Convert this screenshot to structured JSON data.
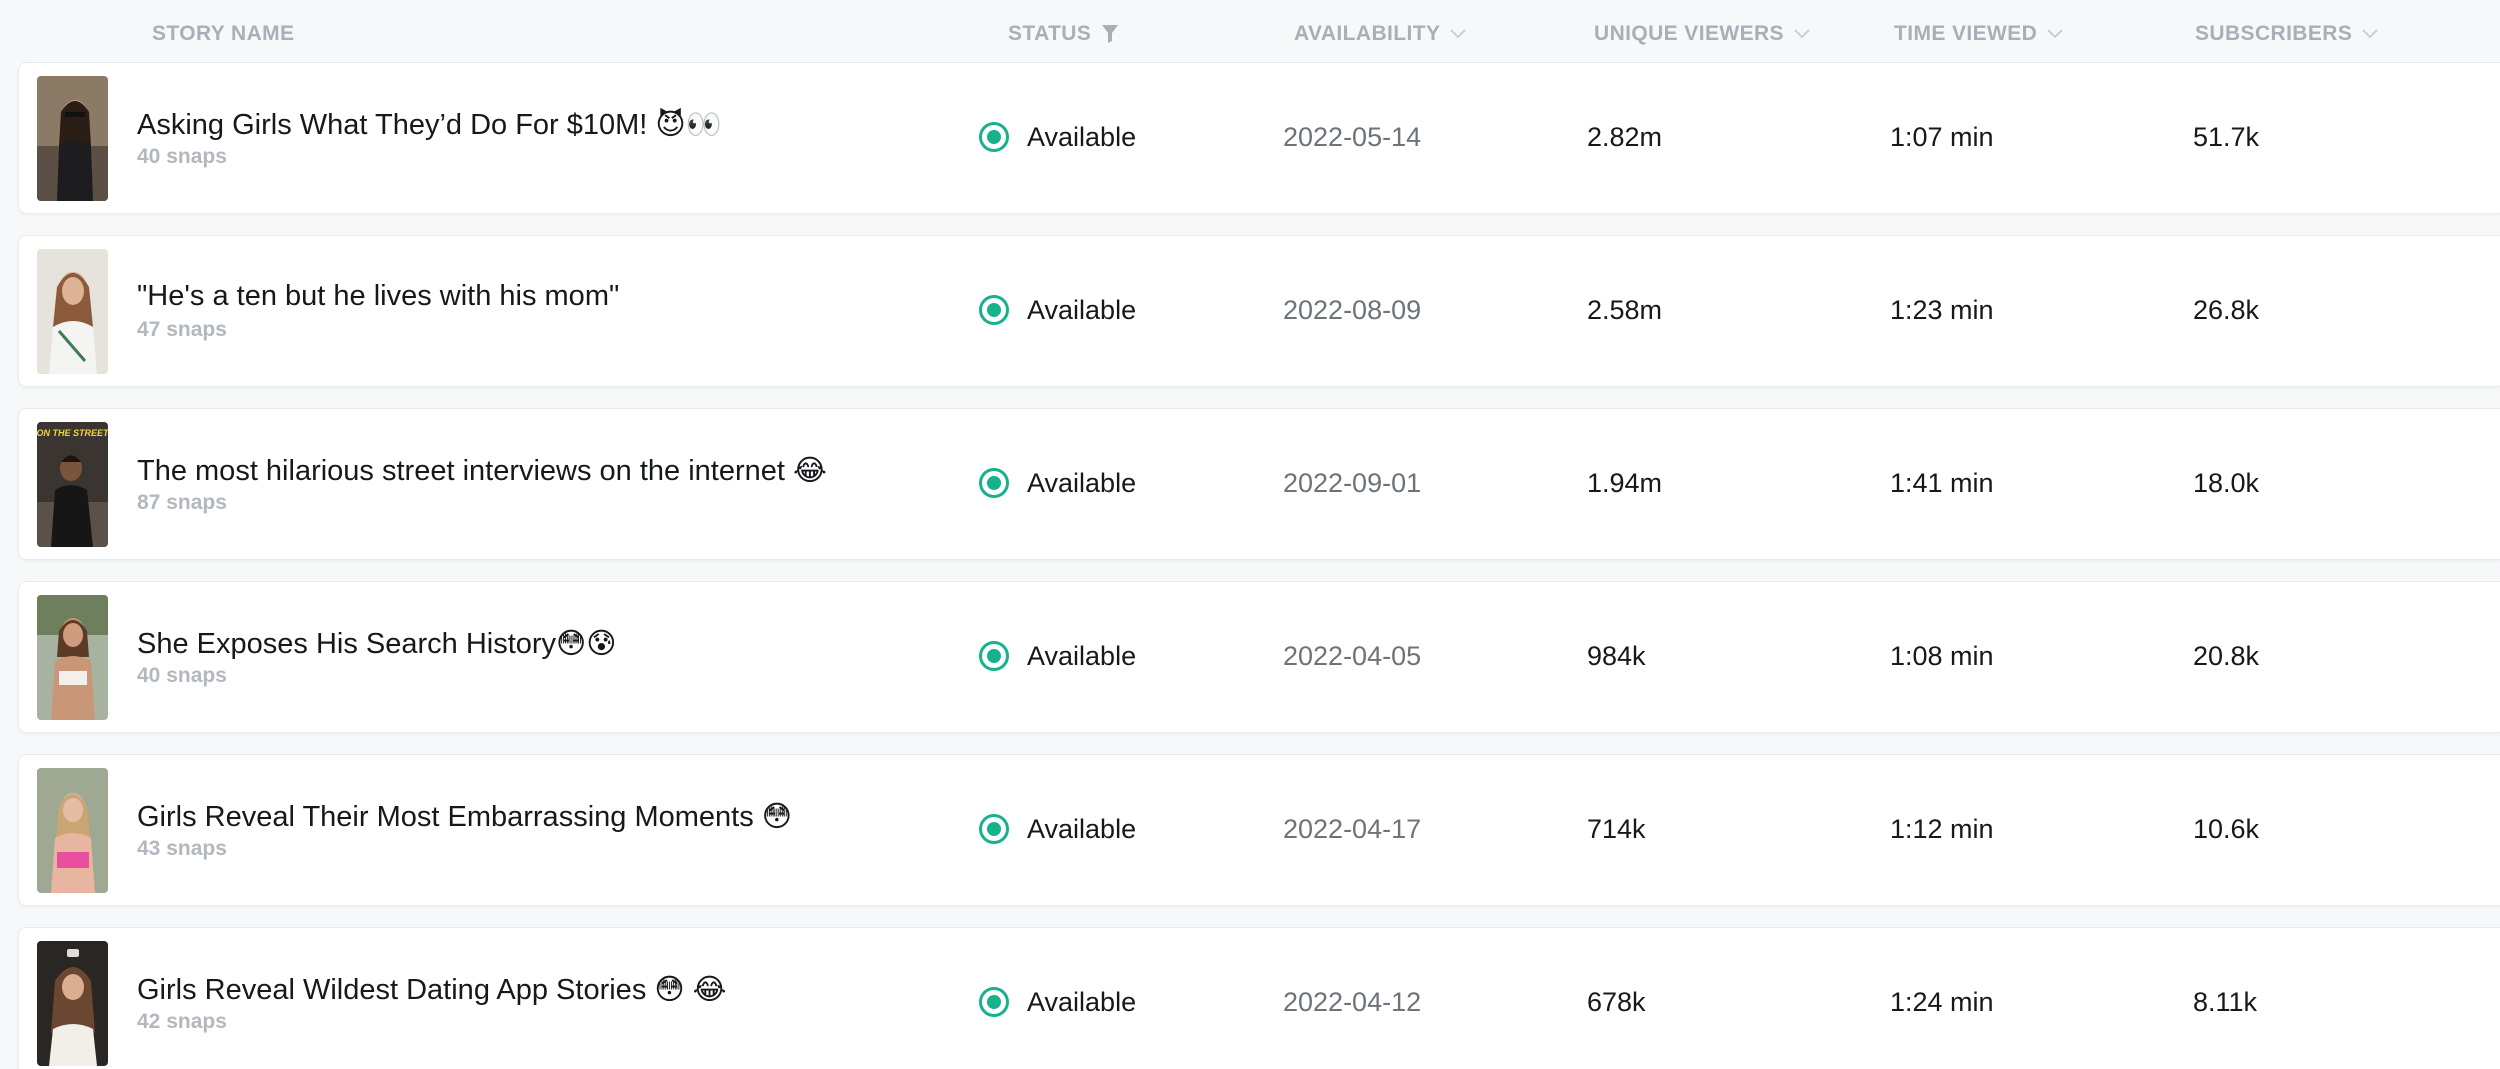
{
  "columns": {
    "story_name": "STORY NAME",
    "status": "STATUS",
    "availability": "AVAILABILITY",
    "unique_viewers": "UNIQUE VIEWERS",
    "time_viewed": "TIME VIEWED",
    "subscribers": "SUBSCRIBERS"
  },
  "icons": {
    "status_filter": "filter-icon",
    "sort": "chevron-down-icon",
    "status_indicator": "status-available-icon"
  },
  "colors": {
    "status_green": "#16b28e",
    "header_text": "#a9afb7",
    "date_text": "#6d737a"
  },
  "rows": [
    {
      "name": "Asking Girls What They’d Do For $10M! 😈👀",
      "snaps": "40 snaps",
      "status": "Available",
      "availability": "2022-05-14",
      "unique_viewers": "2.82m",
      "time_viewed": "1:07 min",
      "subscribers": "51.7k"
    },
    {
      "name": "\"He's a ten but he lives with his mom\"",
      "snaps": "47 snaps",
      "status": "Available",
      "availability": "2022-08-09",
      "unique_viewers": "2.58m",
      "time_viewed": "1:23 min",
      "subscribers": "26.8k"
    },
    {
      "name": "The most hilarious street interviews on the internet 😂",
      "snaps": "87 snaps",
      "status": "Available",
      "availability": "2022-09-01",
      "unique_viewers": "1.94m",
      "time_viewed": "1:41 min",
      "subscribers": "18.0k",
      "thumb_text": "ON THE STREET"
    },
    {
      "name": "She Exposes His Search History😳😰",
      "snaps": "40 snaps",
      "status": "Available",
      "availability": "2022-04-05",
      "unique_viewers": "984k",
      "time_viewed": "1:08 min",
      "subscribers": "20.8k"
    },
    {
      "name": "Girls Reveal Their Most Embarrassing Moments 😳",
      "snaps": "43 snaps",
      "status": "Available",
      "availability": "2022-04-17",
      "unique_viewers": "714k",
      "time_viewed": "1:12 min",
      "subscribers": "10.6k"
    },
    {
      "name": "Girls Reveal Wildest Dating App Stories 😳 😂",
      "snaps": "42 snaps",
      "status": "Available",
      "availability": "2022-04-12",
      "unique_viewers": "678k",
      "time_viewed": "1:24 min",
      "subscribers": "8.11k"
    }
  ]
}
